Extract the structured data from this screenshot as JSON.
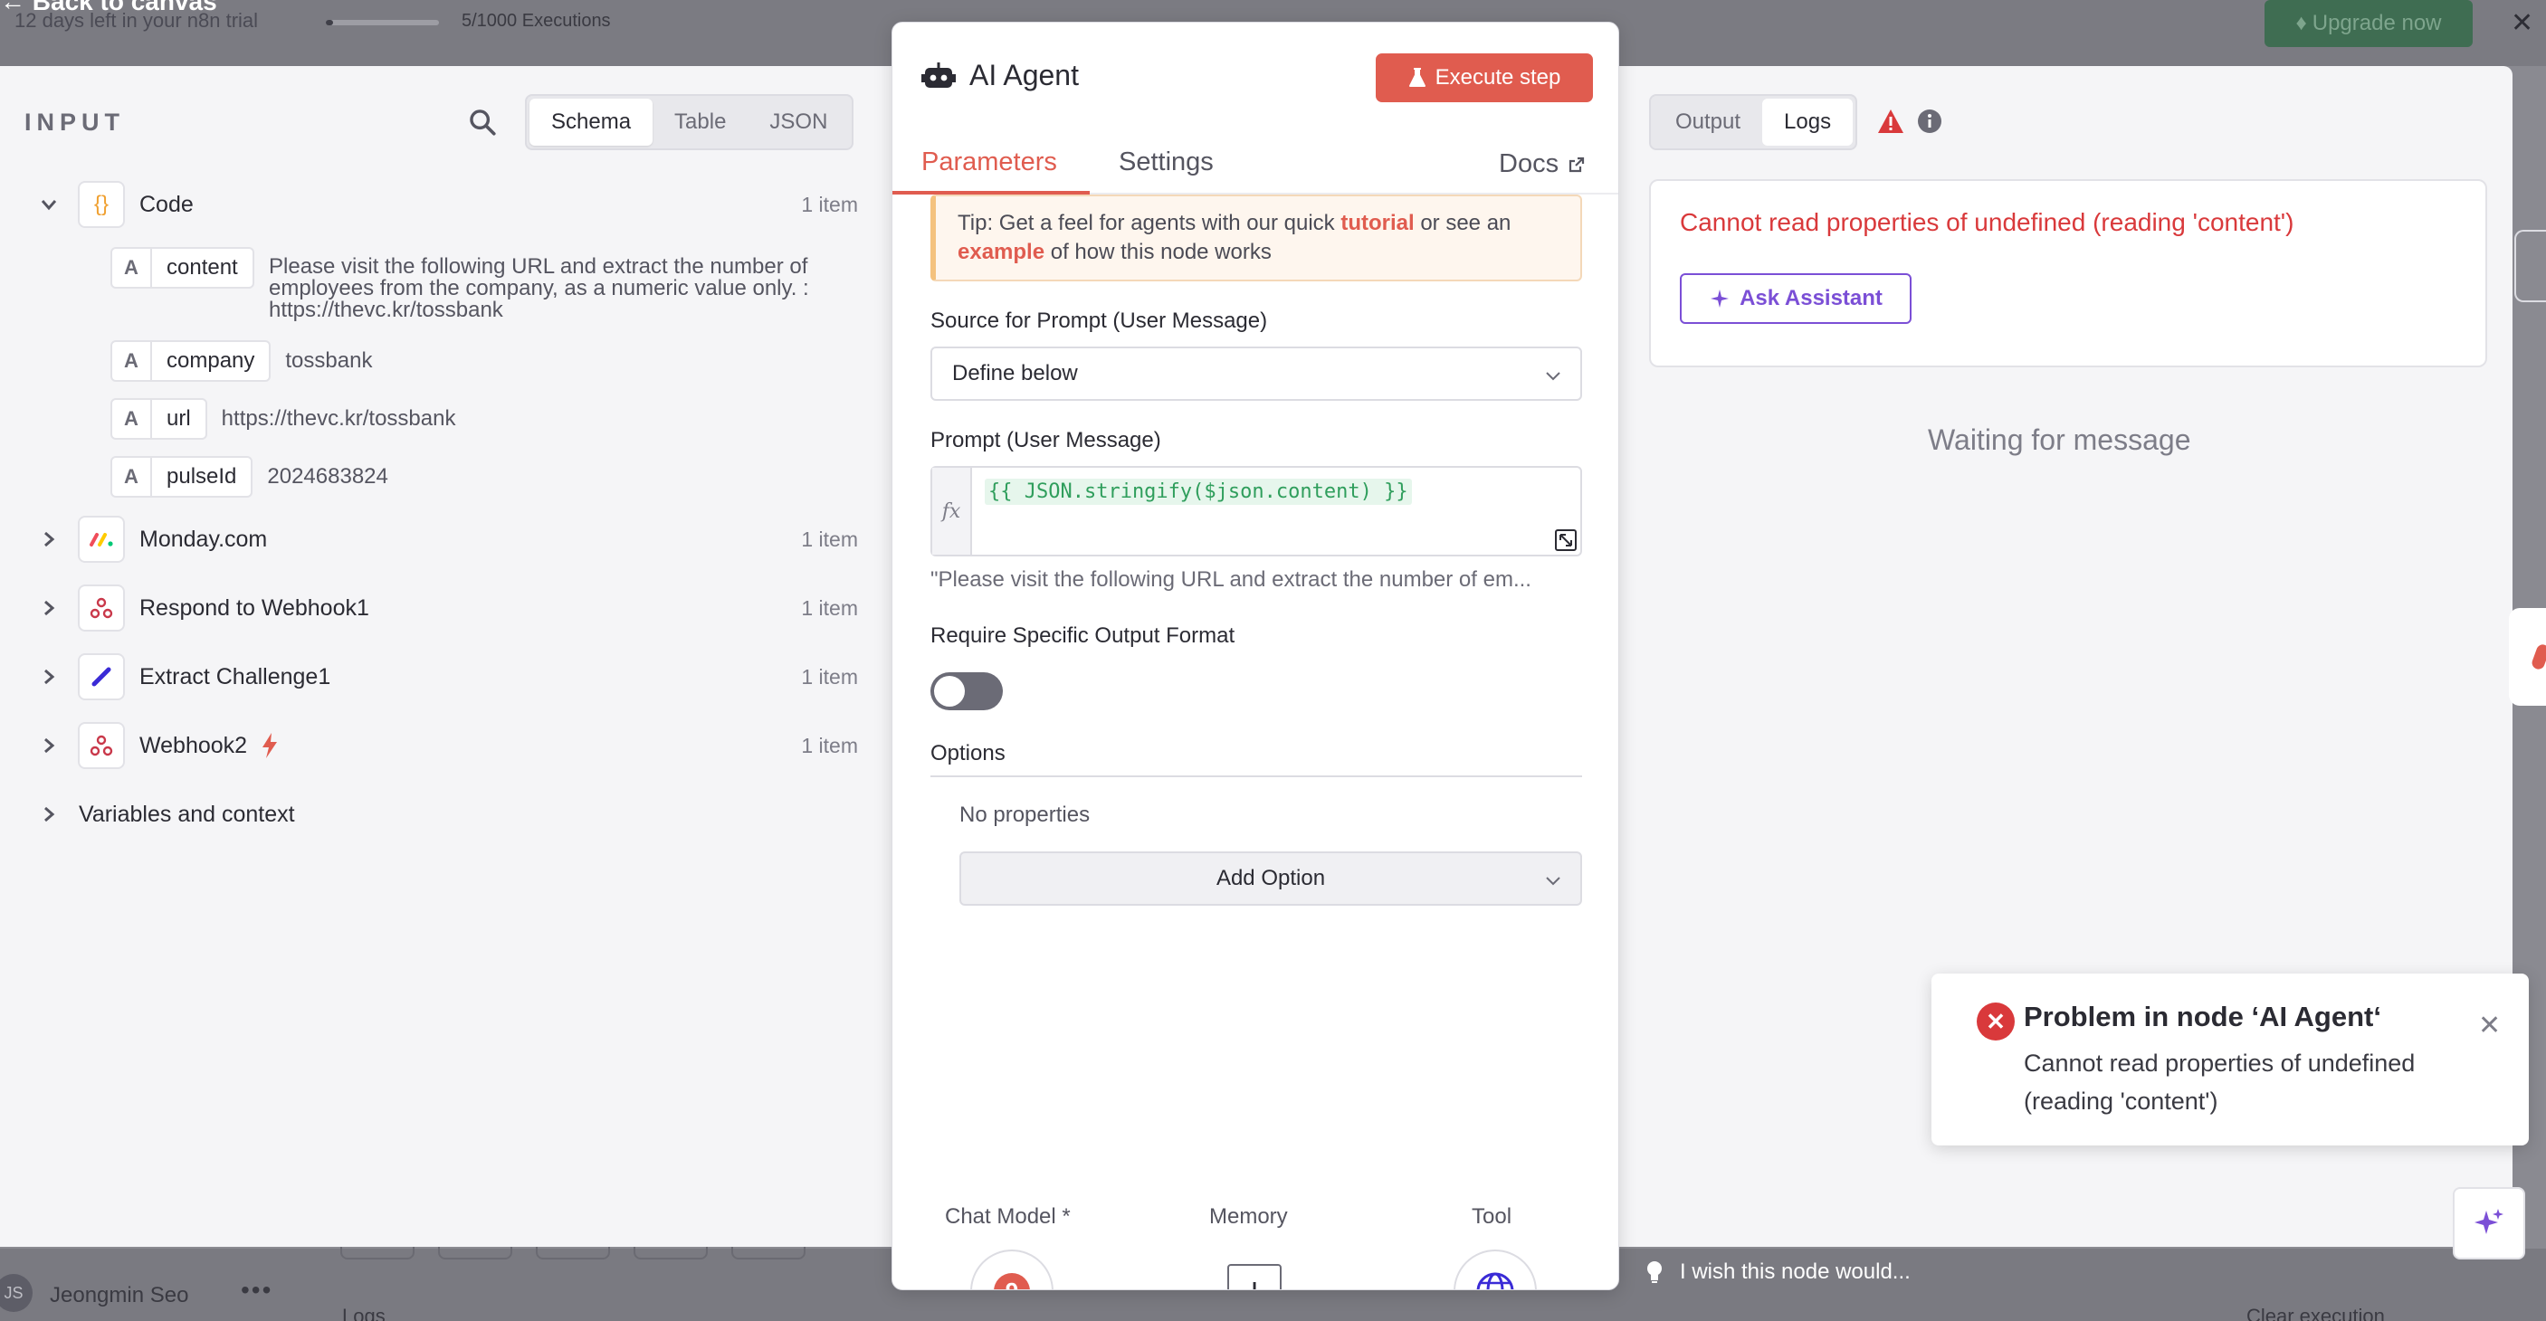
{
  "background": {
    "back_to_canvas": "Back to canvas",
    "trial_text": "12 days left in your n8n trial",
    "executions": "5/1000 Executions",
    "upgrade_label": "Upgrade now",
    "user_initials": "JS",
    "user_name": "Jeongmin Seo",
    "logs_label": "Logs",
    "clear_execution": "Clear execution",
    "wish_text": "I wish this node would..."
  },
  "input": {
    "title": "INPUT",
    "view_modes": [
      "Schema",
      "Table",
      "JSON"
    ],
    "active_mode": "Schema",
    "nodes": [
      {
        "name": "Code",
        "count": "1 item",
        "icon": "braces-icon",
        "expanded": true
      },
      {
        "name": "Monday.com",
        "count": "1 item",
        "icon": "monday-icon"
      },
      {
        "name": "Respond to Webhook1",
        "count": "1 item",
        "icon": "webhook-icon"
      },
      {
        "name": "Extract Challenge1",
        "count": "1 item",
        "icon": "pencil-icon"
      },
      {
        "name": "Webhook2",
        "count": "1 item",
        "icon": "webhook-icon",
        "trigger": true
      }
    ],
    "fields": [
      {
        "type": "A",
        "name": "content",
        "value": "Please visit the following URL and extract the number of employees from the company, as a numeric value only. : https://thevc.kr/tossbank"
      },
      {
        "type": "A",
        "name": "company",
        "value": "tossbank"
      },
      {
        "type": "A",
        "name": "url",
        "value": "https://thevc.kr/tossbank"
      },
      {
        "type": "A",
        "name": "pulseId",
        "value": "2024683824"
      }
    ],
    "variables_label": "Variables and context"
  },
  "node": {
    "title": "AI Agent",
    "execute_label": "Execute step",
    "tabs": [
      "Parameters",
      "Settings"
    ],
    "active_tab": "Parameters",
    "docs_label": "Docs",
    "tip": {
      "before": "Tip: Get a feel for agents with our quick ",
      "link1": "tutorial",
      "middle": " or see an ",
      "link2": "example",
      "after": " of how this node works"
    },
    "source_label": "Source for Prompt (User Message)",
    "source_value": "Define below",
    "prompt_label": "Prompt (User Message)",
    "prompt_expression": "{{ JSON.stringify($json.content) }}",
    "prompt_preview": "\"Please visit the following URL and extract the number of em...",
    "output_format_label": "Require Specific Output Format",
    "output_format_enabled": false,
    "options_label": "Options",
    "no_properties": "No properties",
    "add_option": "Add Option",
    "sub_nodes": [
      "Chat Model *",
      "Memory",
      "Tool"
    ]
  },
  "output": {
    "view_modes": [
      "Output",
      "Logs"
    ],
    "active_mode": "Logs",
    "error_message": "Cannot read properties of undefined (reading 'content')",
    "ask_assistant": "Ask Assistant",
    "waiting": "Waiting for message"
  },
  "toast": {
    "title": "Problem in node ‘AI Agent‘",
    "message": "Cannot read properties of undefined (reading 'content')"
  },
  "colors": {
    "accent": "#e05c4f",
    "error": "#d9393b",
    "assistant": "#7b4fd6"
  }
}
